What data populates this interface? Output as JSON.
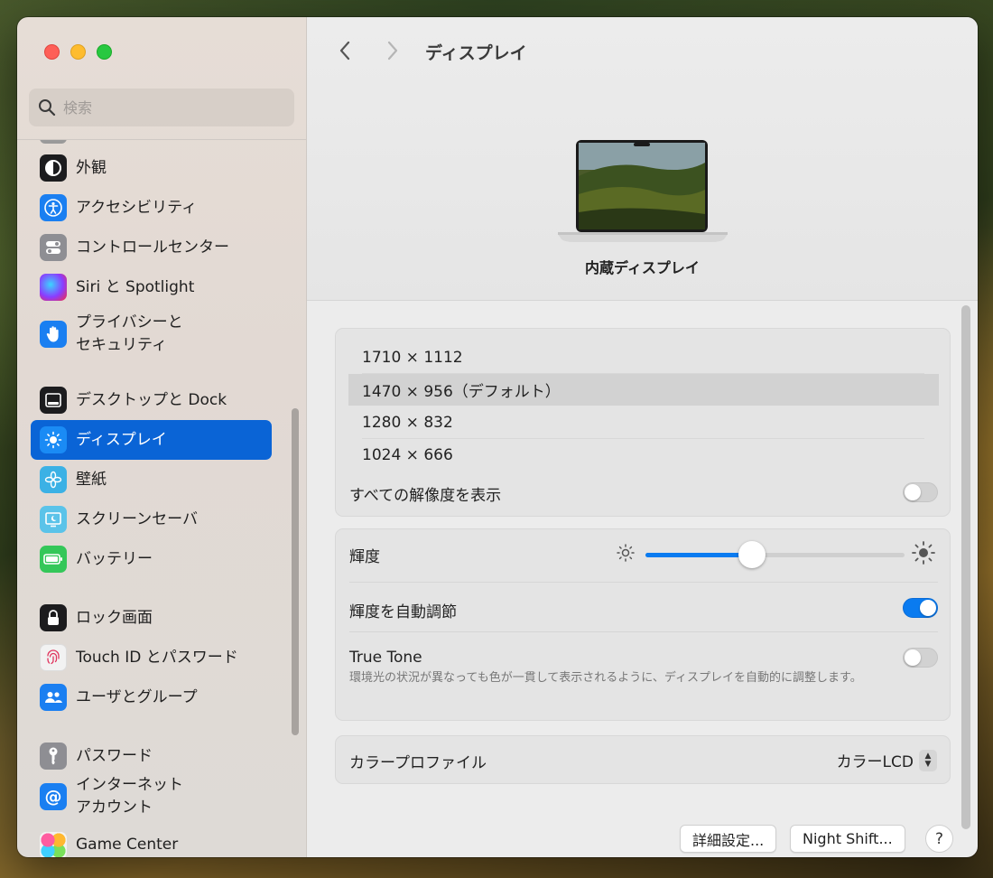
{
  "search": {
    "placeholder": "検索"
  },
  "sidebar": {
    "items": [
      {
        "label": "外観",
        "icon": "appearance-icon",
        "color": "#1c1c1e"
      },
      {
        "label": "アクセシビリティ",
        "icon": "accessibility-icon",
        "color": "#1a7ff1"
      },
      {
        "label": "コントロールセンター",
        "icon": "control-center-icon",
        "color": "#8e8e93"
      },
      {
        "label": "Siri と Spotlight",
        "icon": "siri-icon",
        "color": "#c23a8a"
      },
      {
        "label": "プライバシーと\nセキュリティ",
        "icon": "privacy-hand-icon",
        "color": "#1a7ff1"
      },
      {
        "label": "デスクトップと Dock",
        "icon": "dock-icon",
        "color": "#1c1c1e"
      },
      {
        "label": "ディスプレイ",
        "icon": "display-sun-icon",
        "color": "#1a8bf5"
      },
      {
        "label": "壁紙",
        "icon": "wallpaper-icon",
        "color": "#3bb1e5"
      },
      {
        "label": "スクリーンセーバ",
        "icon": "screensaver-icon",
        "color": "#5ac3e9"
      },
      {
        "label": "バッテリー",
        "icon": "battery-icon",
        "color": "#34c759"
      },
      {
        "label": "ロック画面",
        "icon": "lock-icon",
        "color": "#1c1c1e"
      },
      {
        "label": "Touch ID とパスワード",
        "icon": "fingerprint-icon",
        "color": "#f2f2f2"
      },
      {
        "label": "ユーザとグループ",
        "icon": "users-icon",
        "color": "#1a7ff1"
      },
      {
        "label": "パスワード",
        "icon": "key-icon",
        "color": "#8e8e93"
      },
      {
        "label": "インターネット\nアカウント",
        "icon": "at-sign-icon",
        "color": "#1a7ff1"
      },
      {
        "label": "Game Center",
        "icon": "game-center-icon",
        "color": "#f2f2f2"
      }
    ]
  },
  "header": {
    "title": "ディスプレイ",
    "display_name": "内蔵ディスプレイ"
  },
  "resolutions": {
    "options": [
      "1710 × 1112",
      "1470 × 956（デフォルト）",
      "1280 × 832",
      "1024 × 666"
    ],
    "selected": "1470 × 956（デフォルト）",
    "show_all_label": "すべての解像度を表示",
    "show_all": false
  },
  "brightness": {
    "label": "輝度",
    "value": 0.41,
    "auto_label": "輝度を自動調節",
    "auto": true
  },
  "true_tone": {
    "label": "True Tone",
    "description": "環境光の状況が異なっても色が一貫して表示されるように、ディスプレイを自動的に調整します。",
    "enabled": false
  },
  "color_profile": {
    "label": "カラープロファイル",
    "value": "カラーLCD"
  },
  "buttons": {
    "advanced": "詳細設定...",
    "night_shift": "Night Shift...",
    "help": "?"
  },
  "colors": {
    "accent": "#0a7bf0",
    "selected_sidebar": "#0a64d6"
  }
}
